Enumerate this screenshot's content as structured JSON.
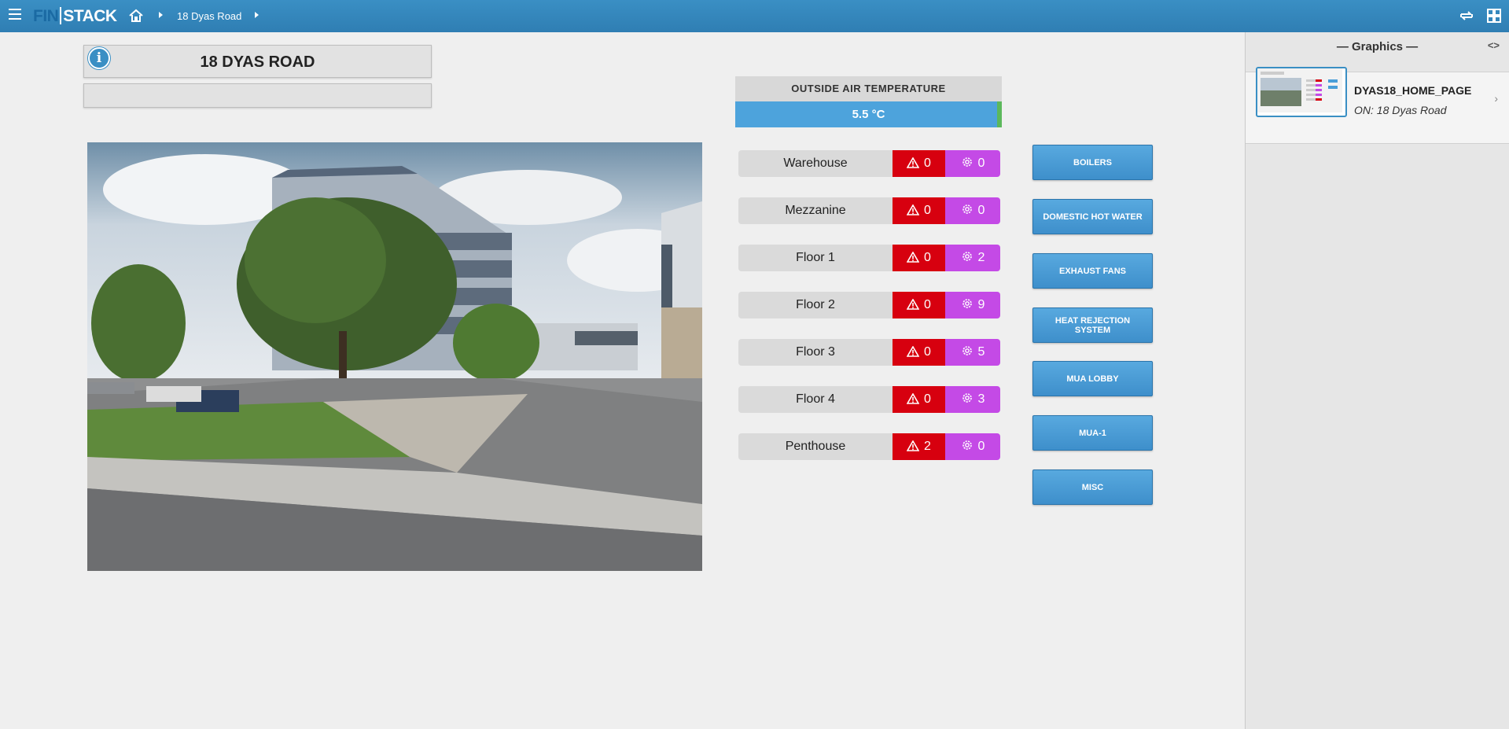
{
  "app": {
    "logo_fin": "FIN",
    "logo_stack": "STACK"
  },
  "breadcrumb": {
    "site": "18 Dyas Road"
  },
  "site": {
    "title": "18 DYAS ROAD",
    "subtitle": ""
  },
  "oat": {
    "label": "OUTSIDE AIR TEMPERATURE",
    "value": "5.5 °C"
  },
  "zones": [
    {
      "name": "Warehouse",
      "alarms": "0",
      "faults": "0"
    },
    {
      "name": "Mezzanine",
      "alarms": "0",
      "faults": "0"
    },
    {
      "name": "Floor 1",
      "alarms": "0",
      "faults": "2"
    },
    {
      "name": "Floor 2",
      "alarms": "0",
      "faults": "9"
    },
    {
      "name": "Floor 3",
      "alarms": "0",
      "faults": "5"
    },
    {
      "name": "Floor 4",
      "alarms": "0",
      "faults": "3"
    },
    {
      "name": "Penthouse",
      "alarms": "2",
      "faults": "0"
    }
  ],
  "systems": [
    "BOILERS",
    "DOMESTIC HOT WATER",
    "EXHAUST FANS",
    "HEAT REJECTION SYSTEM",
    "MUA LOBBY",
    "MUA-1",
    "MISC"
  ],
  "panel": {
    "title": "— Graphics —",
    "toggle": "<>",
    "graphic_name": "DYAS18_HOME_PAGE",
    "graphic_on": "ON: 18 Dyas Road",
    "chevron": "›"
  },
  "colors": {
    "topbar": "#3a8fc4",
    "alarm": "#d7000f",
    "fault": "#c44ae6",
    "button": "#4a9ed8",
    "oat_value": "#4da3dc"
  }
}
